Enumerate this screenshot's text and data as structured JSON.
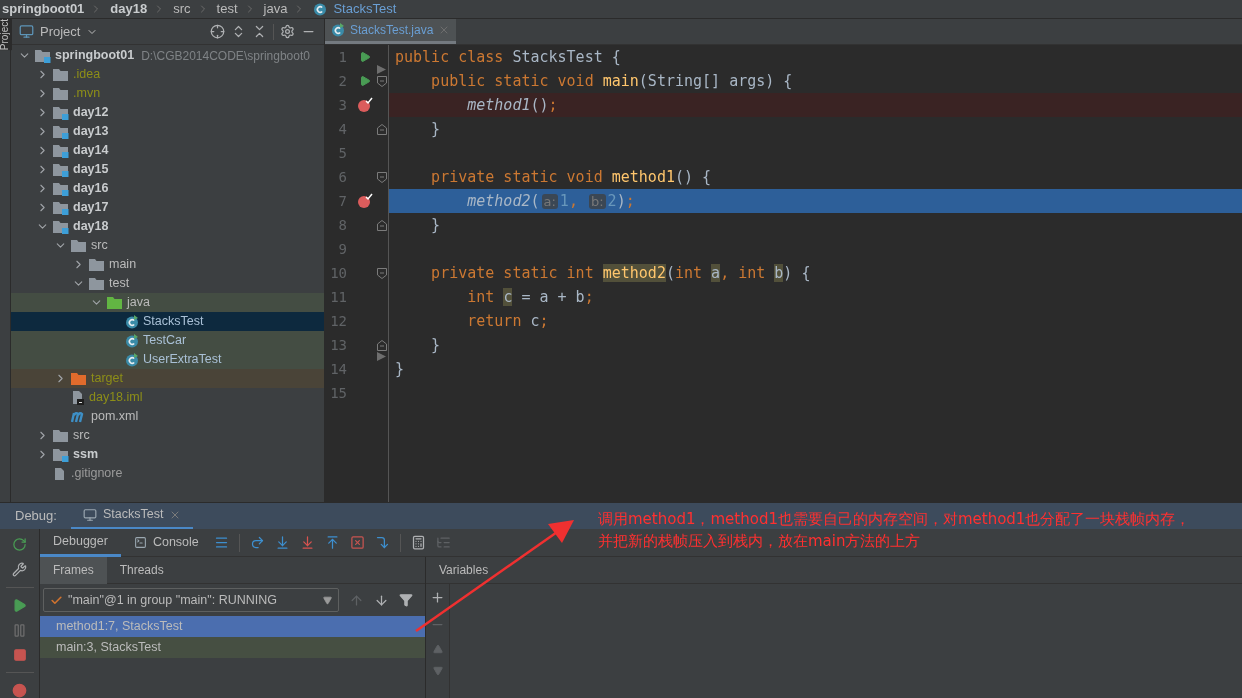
{
  "breadcrumb": [
    {
      "label": "springboot01",
      "kind": "module"
    },
    {
      "label": "day18",
      "kind": "module"
    },
    {
      "label": "src",
      "kind": "folder"
    },
    {
      "label": "test",
      "kind": "folder"
    },
    {
      "label": "java",
      "kind": "folder"
    },
    {
      "label": "StacksTest",
      "kind": "class"
    }
  ],
  "side_tab": {
    "label": "Project"
  },
  "project": {
    "title": "Project",
    "tree": [
      {
        "name": "springboot01",
        "kind": "module",
        "path": "D:\\CGB2014CODE\\springboot0",
        "expanded": true,
        "selected": false,
        "children": [
          {
            "name": ".idea",
            "kind": "ignored-folder",
            "expanded": false,
            "selected": false
          },
          {
            "name": ".mvn",
            "kind": "ignored-folder",
            "expanded": false,
            "selected": false
          },
          {
            "name": "day12",
            "kind": "module",
            "expanded": false,
            "selected": false
          },
          {
            "name": "day13",
            "kind": "module",
            "expanded": false,
            "selected": false
          },
          {
            "name": "day14",
            "kind": "module",
            "expanded": false,
            "selected": false
          },
          {
            "name": "day15",
            "kind": "module",
            "expanded": false,
            "selected": false
          },
          {
            "name": "day16",
            "kind": "module",
            "expanded": false,
            "selected": false
          },
          {
            "name": "day17",
            "kind": "module",
            "expanded": false,
            "selected": false
          },
          {
            "name": "day18",
            "kind": "module",
            "expanded": true,
            "selected": false,
            "children": [
              {
                "name": "src",
                "kind": "folder",
                "expanded": true,
                "selected": false,
                "children": [
                  {
                    "name": "main",
                    "kind": "folder",
                    "expanded": false,
                    "selected": false
                  },
                  {
                    "name": "test",
                    "kind": "folder",
                    "expanded": true,
                    "selected": false,
                    "children": [
                      {
                        "name": "java",
                        "kind": "test-root",
                        "expanded": true,
                        "selected": false,
                        "children": [
                          {
                            "name": "StacksTest",
                            "kind": "test-class",
                            "selected": true
                          },
                          {
                            "name": "TestCar",
                            "kind": "test-class",
                            "selected": false
                          },
                          {
                            "name": "UserExtraTest",
                            "kind": "test-class",
                            "selected": false
                          }
                        ]
                      }
                    ]
                  }
                ]
              },
              {
                "name": "target",
                "kind": "excluded-folder",
                "expanded": false,
                "selected": false
              },
              {
                "name": "day18.iml",
                "kind": "iml",
                "selected": false
              },
              {
                "name": "pom.xml",
                "kind": "maven",
                "selected": false
              }
            ]
          },
          {
            "name": "src",
            "kind": "folder",
            "expanded": false,
            "selected": false
          },
          {
            "name": "ssm",
            "kind": "module",
            "expanded": false,
            "selected": false
          },
          {
            "name": ".gitignore",
            "kind": "gitignore",
            "selected": false
          }
        ]
      }
    ]
  },
  "editor": {
    "tabs": [
      {
        "label": "StacksTest.java",
        "selected": true
      }
    ],
    "lines": [
      {
        "number": "1",
        "run": true,
        "breakpoint": false,
        "execution_point": false,
        "fold": {
          "kind": "class-start"
        },
        "tokens": [
          {
            "kind": "keyword",
            "text": "public class "
          },
          {
            "kind": "plain",
            "text": "StacksTest {"
          }
        ]
      },
      {
        "number": "2",
        "run": true,
        "breakpoint": false,
        "execution_point": false,
        "fold": {
          "kind": "open"
        },
        "tokens": [
          {
            "kind": "keyword",
            "text": "    public static void "
          },
          {
            "kind": "decl",
            "text": "main"
          },
          {
            "kind": "plain",
            "text": "(String[] args) {"
          }
        ]
      },
      {
        "number": "3",
        "run": false,
        "breakpoint": true,
        "execution_point": false,
        "tokens": [
          {
            "kind": "call",
            "text": "        method1"
          },
          {
            "kind": "plain",
            "text": "()"
          },
          {
            "kind": "keyword",
            "text": ";"
          }
        ]
      },
      {
        "number": "4",
        "run": false,
        "breakpoint": false,
        "execution_point": false,
        "fold": {
          "kind": "close"
        },
        "tokens": [
          {
            "kind": "plain",
            "text": "    }"
          }
        ]
      },
      {
        "number": "5",
        "run": false,
        "breakpoint": false,
        "execution_point": false
      },
      {
        "number": "6",
        "run": false,
        "breakpoint": false,
        "execution_point": false,
        "fold": {
          "kind": "open"
        },
        "tokens": [
          {
            "kind": "keyword",
            "text": "    private static void "
          },
          {
            "kind": "decl",
            "text": "method1"
          },
          {
            "kind": "plain",
            "text": "() {"
          }
        ]
      },
      {
        "number": "7",
        "run": false,
        "breakpoint": true,
        "execution_point": true,
        "tokens": [
          {
            "kind": "call",
            "text": "        method2"
          },
          {
            "kind": "plain",
            "text": "("
          },
          {
            "kind": "hint",
            "text": "a:"
          },
          {
            "kind": "number",
            "text": "1"
          },
          {
            "kind": "keyword",
            "text": ", "
          },
          {
            "kind": "hint",
            "text": "b:"
          },
          {
            "kind": "number",
            "text": "2"
          },
          {
            "kind": "plain",
            "text": ")"
          },
          {
            "kind": "keyword",
            "text": ";"
          }
        ]
      },
      {
        "number": "8",
        "run": false,
        "breakpoint": false,
        "execution_point": false,
        "fold": {
          "kind": "close"
        },
        "tokens": [
          {
            "kind": "plain",
            "text": "    }"
          }
        ]
      },
      {
        "number": "9",
        "run": false,
        "breakpoint": false,
        "execution_point": false
      },
      {
        "number": "10",
        "run": false,
        "breakpoint": false,
        "execution_point": false,
        "fold": {
          "kind": "open"
        },
        "tokens": [
          {
            "kind": "keyword",
            "text": "    private static int "
          },
          {
            "kind": "decl-usage",
            "text": "method2"
          },
          {
            "kind": "plain",
            "text": "("
          },
          {
            "kind": "keyword",
            "text": "int "
          },
          {
            "kind": "usage",
            "text": "a"
          },
          {
            "kind": "keyword",
            "text": ", int "
          },
          {
            "kind": "usage",
            "text": "b"
          },
          {
            "kind": "plain",
            "text": ") {"
          }
        ]
      },
      {
        "number": "11",
        "run": false,
        "breakpoint": false,
        "execution_point": false,
        "tokens": [
          {
            "kind": "keyword",
            "text": "        int "
          },
          {
            "kind": "usage",
            "text": "c"
          },
          {
            "kind": "plain",
            "text": " = a + b"
          },
          {
            "kind": "keyword",
            "text": ";"
          }
        ]
      },
      {
        "number": "12",
        "run": false,
        "breakpoint": false,
        "execution_point": false,
        "tokens": [
          {
            "kind": "keyword",
            "text": "        return "
          },
          {
            "kind": "plain",
            "text": "c"
          },
          {
            "kind": "keyword",
            "text": ";"
          }
        ]
      },
      {
        "number": "13",
        "run": false,
        "breakpoint": false,
        "execution_point": false,
        "fold": {
          "kind": "close"
        },
        "tokens": [
          {
            "kind": "plain",
            "text": "    }"
          }
        ]
      },
      {
        "number": "14",
        "run": false,
        "breakpoint": false,
        "execution_point": false,
        "fold": {
          "kind": "class-end"
        },
        "tokens": [
          {
            "kind": "plain",
            "text": "}"
          }
        ]
      },
      {
        "number": "15",
        "run": false,
        "breakpoint": false,
        "execution_point": false
      }
    ]
  },
  "debug": {
    "label": "Debug:",
    "session": {
      "title": "StacksTest"
    },
    "tabs": [
      {
        "label": "Debugger",
        "selected": true
      },
      {
        "label": "Console",
        "selected": false
      }
    ],
    "frame_tabs": [
      {
        "label": "Frames",
        "selected": true
      },
      {
        "label": "Threads",
        "selected": false
      }
    ],
    "thread": {
      "value": "\"main\"@1 in group \"main\": RUNNING"
    },
    "frames": [
      {
        "label": "method1:7, StacksTest",
        "selected": true
      },
      {
        "label": "main:3, StacksTest",
        "selected": false
      }
    ],
    "variables": {
      "title": "Variables"
    }
  },
  "annotation": {
    "lines": [
      "调用method1，method1也需要自己的内存空间，对method1也分配了一块栈帧内存，",
      "并把新的栈帧压入到栈内，放在main方法的上方"
    ]
  }
}
